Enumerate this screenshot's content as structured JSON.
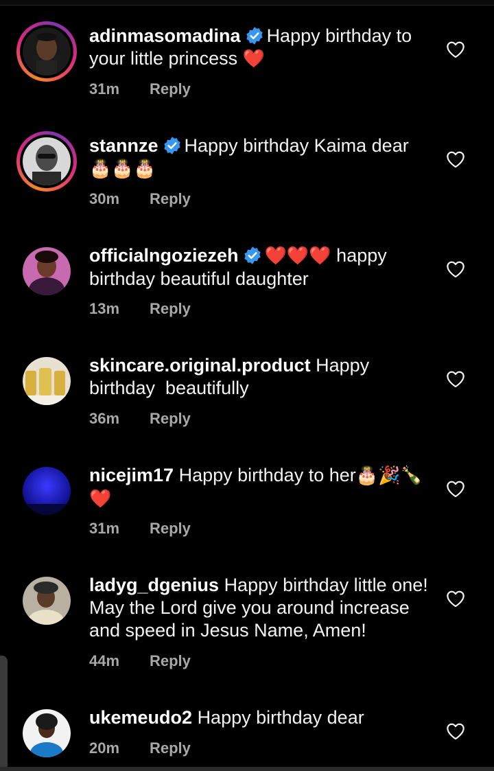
{
  "comments": [
    {
      "username": "adinmasomadina",
      "verified": true,
      "text": "Happy birthday to your little princess",
      "emoji": "❤️",
      "time": "31m",
      "reply": "Reply",
      "story_ring": true
    },
    {
      "username": "stannze",
      "verified": true,
      "text": "Happy birthday Kaima dear",
      "emoji": "🎂🎂🎂",
      "time": "30m",
      "reply": "Reply",
      "story_ring": true
    },
    {
      "username": "officialngoziezeh",
      "verified": true,
      "emoji_prefix": "❤️❤️❤️",
      "text": "happy birthday beautiful daughter",
      "time": "13m",
      "reply": "Reply",
      "story_ring": false
    },
    {
      "username": "skincare.original.product",
      "verified": false,
      "text": "Happy birthday  beautifully",
      "time": "36m",
      "reply": "Reply",
      "story_ring": false
    },
    {
      "username": "nicejim17",
      "verified": false,
      "text": "Happy birthday to her",
      "emoji": "🎂🎉🍾❤️",
      "time": "31m",
      "reply": "Reply",
      "story_ring": false
    },
    {
      "username": "ladyg_dgenius",
      "verified": false,
      "text": "Happy birthday little one! May the Lord give you around increase and speed in Jesus Name, Amen!",
      "time": "44m",
      "reply": "Reply",
      "story_ring": false
    },
    {
      "username": "ukemeudo2",
      "verified": false,
      "text": "Happy birthday dear",
      "time": "20m",
      "reply": "Reply",
      "story_ring": false
    }
  ],
  "icons": {
    "verified": "verified-badge-icon",
    "like": "heart-outline-icon"
  },
  "colors": {
    "background": "#000000",
    "text": "#f2f2f2",
    "meta": "#a8a8a8",
    "verified": "#3897f0"
  }
}
